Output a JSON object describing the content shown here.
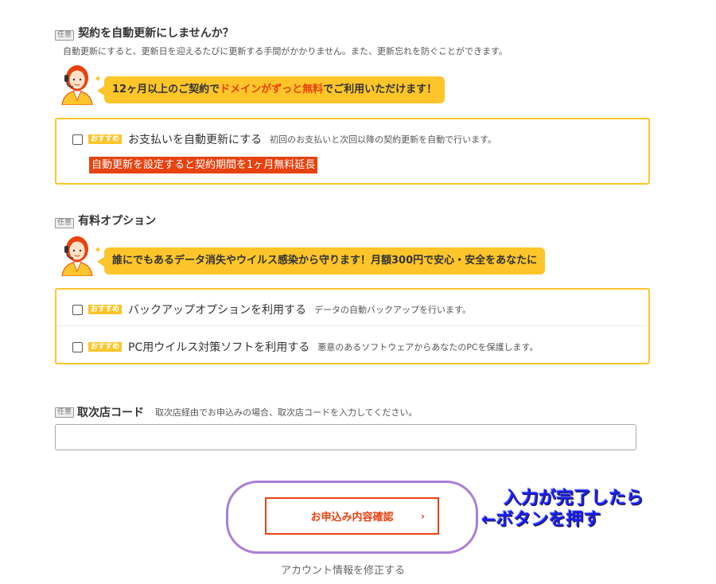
{
  "auto_renew": {
    "tag": "任意",
    "title": "契約を自動更新にしませんか？",
    "description": "自動更新にすると、更新日を迎えるたびに更新する手間がかかりません。また、更新忘れを防ぐことができます。",
    "bubble_pre": "12ヶ月以上のご契約で",
    "bubble_highlight": "ドメインがずっと無料",
    "bubble_post": "でご利用いただけます！",
    "option": {
      "badge": "おすすめ",
      "label": "お支払いを自動更新にする",
      "sub": "初回のお支払いと次回以降の契約更新を自動で行います。",
      "checked": false
    },
    "promo": "自動更新を設定すると契約期間を1ヶ月無料延長"
  },
  "paid_options": {
    "tag": "任意",
    "title": "有料オプション",
    "bubble": "誰にでもあるデータ消失やウイルス感染から守ります！月額300円で安心・安全をあなたに",
    "options": [
      {
        "badge": "おすすめ",
        "label": "バックアップオプションを利用する",
        "sub": "データの自動バックアップを行います。",
        "checked": false
      },
      {
        "badge": "おすすめ",
        "label": "PC用ウイルス対策ソフトを利用する",
        "sub": "悪意のあるソフトウェアからあなたのPCを保護します。",
        "checked": false
      }
    ]
  },
  "agent_code": {
    "tag": "任意",
    "title": "取次店コード",
    "description": "取次店経由でお申込みの場合、取次店コードを入力してください。",
    "value": ""
  },
  "actions": {
    "confirm_label": "お申込み内容確認",
    "confirm_chevron": "›",
    "account_link": "アカウント情報を修正する"
  },
  "annotation": {
    "line1": "入力が完了したら",
    "line2": "←ボタンを押す"
  },
  "colors": {
    "accent": "#fdc52a",
    "highlight": "#e8420f",
    "annotation": "#1a1aff",
    "circle": "#a97ed6"
  }
}
